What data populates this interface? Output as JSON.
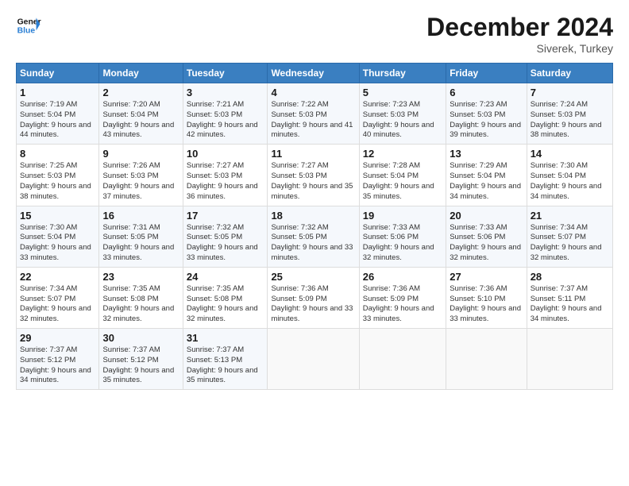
{
  "header": {
    "logo_general": "General",
    "logo_blue": "Blue",
    "month_title": "December 2024",
    "location": "Siverek, Turkey"
  },
  "days_of_week": [
    "Sunday",
    "Monday",
    "Tuesday",
    "Wednesday",
    "Thursday",
    "Friday",
    "Saturday"
  ],
  "weeks": [
    [
      {
        "day": "1",
        "sunrise": "7:19 AM",
        "sunset": "5:04 PM",
        "daylight": "9 hours and 44 minutes."
      },
      {
        "day": "2",
        "sunrise": "7:20 AM",
        "sunset": "5:04 PM",
        "daylight": "9 hours and 43 minutes."
      },
      {
        "day": "3",
        "sunrise": "7:21 AM",
        "sunset": "5:03 PM",
        "daylight": "9 hours and 42 minutes."
      },
      {
        "day": "4",
        "sunrise": "7:22 AM",
        "sunset": "5:03 PM",
        "daylight": "9 hours and 41 minutes."
      },
      {
        "day": "5",
        "sunrise": "7:23 AM",
        "sunset": "5:03 PM",
        "daylight": "9 hours and 40 minutes."
      },
      {
        "day": "6",
        "sunrise": "7:23 AM",
        "sunset": "5:03 PM",
        "daylight": "9 hours and 39 minutes."
      },
      {
        "day": "7",
        "sunrise": "7:24 AM",
        "sunset": "5:03 PM",
        "daylight": "9 hours and 38 minutes."
      }
    ],
    [
      {
        "day": "8",
        "sunrise": "7:25 AM",
        "sunset": "5:03 PM",
        "daylight": "9 hours and 38 minutes."
      },
      {
        "day": "9",
        "sunrise": "7:26 AM",
        "sunset": "5:03 PM",
        "daylight": "9 hours and 37 minutes."
      },
      {
        "day": "10",
        "sunrise": "7:27 AM",
        "sunset": "5:03 PM",
        "daylight": "9 hours and 36 minutes."
      },
      {
        "day": "11",
        "sunrise": "7:27 AM",
        "sunset": "5:03 PM",
        "daylight": "9 hours and 35 minutes."
      },
      {
        "day": "12",
        "sunrise": "7:28 AM",
        "sunset": "5:04 PM",
        "daylight": "9 hours and 35 minutes."
      },
      {
        "day": "13",
        "sunrise": "7:29 AM",
        "sunset": "5:04 PM",
        "daylight": "9 hours and 34 minutes."
      },
      {
        "day": "14",
        "sunrise": "7:30 AM",
        "sunset": "5:04 PM",
        "daylight": "9 hours and 34 minutes."
      }
    ],
    [
      {
        "day": "15",
        "sunrise": "7:30 AM",
        "sunset": "5:04 PM",
        "daylight": "9 hours and 33 minutes."
      },
      {
        "day": "16",
        "sunrise": "7:31 AM",
        "sunset": "5:05 PM",
        "daylight": "9 hours and 33 minutes."
      },
      {
        "day": "17",
        "sunrise": "7:32 AM",
        "sunset": "5:05 PM",
        "daylight": "9 hours and 33 minutes."
      },
      {
        "day": "18",
        "sunrise": "7:32 AM",
        "sunset": "5:05 PM",
        "daylight": "9 hours and 33 minutes."
      },
      {
        "day": "19",
        "sunrise": "7:33 AM",
        "sunset": "5:06 PM",
        "daylight": "9 hours and 32 minutes."
      },
      {
        "day": "20",
        "sunrise": "7:33 AM",
        "sunset": "5:06 PM",
        "daylight": "9 hours and 32 minutes."
      },
      {
        "day": "21",
        "sunrise": "7:34 AM",
        "sunset": "5:07 PM",
        "daylight": "9 hours and 32 minutes."
      }
    ],
    [
      {
        "day": "22",
        "sunrise": "7:34 AM",
        "sunset": "5:07 PM",
        "daylight": "9 hours and 32 minutes."
      },
      {
        "day": "23",
        "sunrise": "7:35 AM",
        "sunset": "5:08 PM",
        "daylight": "9 hours and 32 minutes."
      },
      {
        "day": "24",
        "sunrise": "7:35 AM",
        "sunset": "5:08 PM",
        "daylight": "9 hours and 32 minutes."
      },
      {
        "day": "25",
        "sunrise": "7:36 AM",
        "sunset": "5:09 PM",
        "daylight": "9 hours and 33 minutes."
      },
      {
        "day": "26",
        "sunrise": "7:36 AM",
        "sunset": "5:09 PM",
        "daylight": "9 hours and 33 minutes."
      },
      {
        "day": "27",
        "sunrise": "7:36 AM",
        "sunset": "5:10 PM",
        "daylight": "9 hours and 33 minutes."
      },
      {
        "day": "28",
        "sunrise": "7:37 AM",
        "sunset": "5:11 PM",
        "daylight": "9 hours and 34 minutes."
      }
    ],
    [
      {
        "day": "29",
        "sunrise": "7:37 AM",
        "sunset": "5:12 PM",
        "daylight": "9 hours and 34 minutes."
      },
      {
        "day": "30",
        "sunrise": "7:37 AM",
        "sunset": "5:12 PM",
        "daylight": "9 hours and 35 minutes."
      },
      {
        "day": "31",
        "sunrise": "7:37 AM",
        "sunset": "5:13 PM",
        "daylight": "9 hours and 35 minutes."
      },
      null,
      null,
      null,
      null
    ]
  ]
}
